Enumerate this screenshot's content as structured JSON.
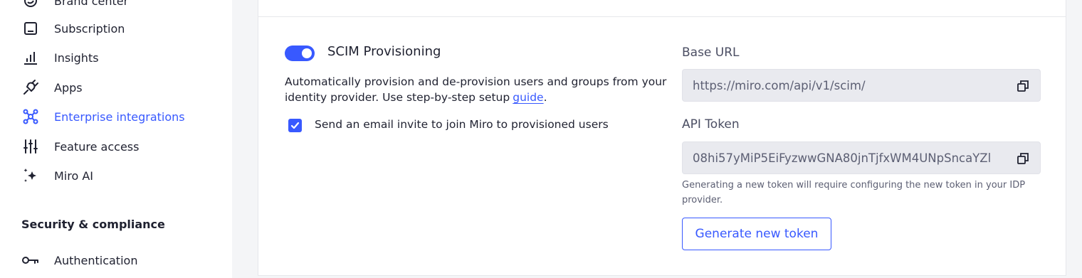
{
  "sidebar": {
    "items": [
      {
        "label": "Brand center",
        "icon": "brand-center-icon"
      },
      {
        "label": "Subscription",
        "icon": "subscription-icon"
      },
      {
        "label": "Insights",
        "icon": "insights-chart-icon"
      },
      {
        "label": "Apps",
        "icon": "plug-icon"
      },
      {
        "label": "Enterprise integrations",
        "icon": "integrations-icon",
        "active": true
      },
      {
        "label": "Feature access",
        "icon": "sliders-icon"
      },
      {
        "label": "Miro AI",
        "icon": "sparkle-icon"
      }
    ],
    "section_heading": "Security & compliance",
    "section_items": [
      {
        "label": "Authentication",
        "icon": "key-icon"
      }
    ]
  },
  "scim": {
    "enabled": true,
    "title": "SCIM Provisioning",
    "description": "Automatically provision and de-provision users and groups from your identity provider. Use step-by-step setup",
    "guide_link": "guide",
    "description_end": ".",
    "email_invite_checked": true,
    "email_invite_label": "Send an email invite to join Miro to provisioned users",
    "base_url_label": "Base URL",
    "base_url_value": "https://miro.com/api/v1/scim/",
    "api_token_label": "API Token",
    "api_token_value": "08hi57yMiP5EiFyzwwGNA80jnTjfxWM4UNpSncaYZl",
    "token_hint": "Generating a new token will require configuring the new token in your IDP provider.",
    "generate_button": "Generate new token"
  },
  "colors": {
    "accent": "#3859ff",
    "text": "#1f2130",
    "muted": "#5c5f73",
    "field_bg": "#e9eaef"
  }
}
